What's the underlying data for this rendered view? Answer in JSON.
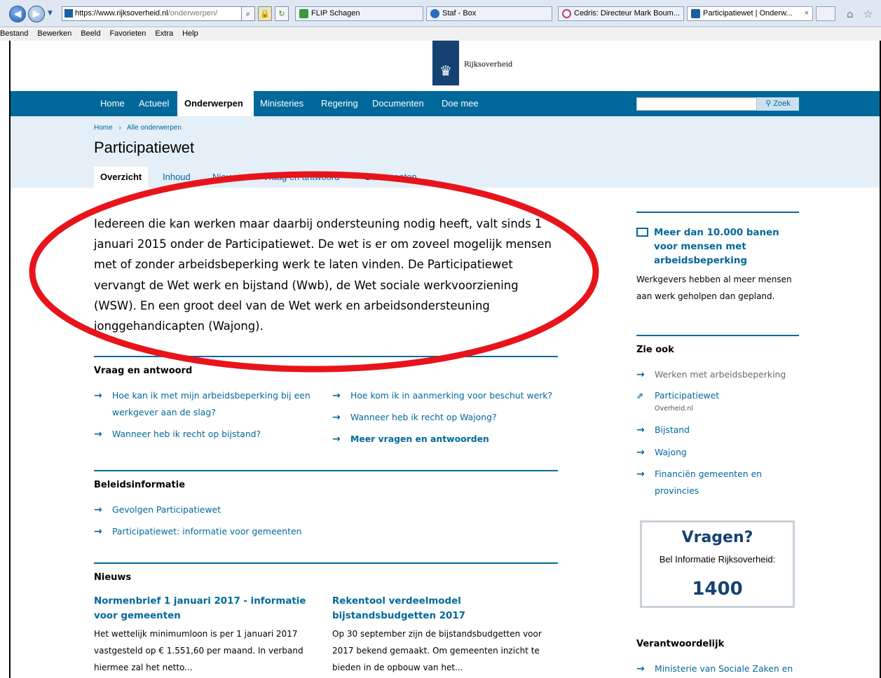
{
  "browser": {
    "url_host": "https://www.rijksoverheid.nl",
    "url_rest": "/onderwerpen/",
    "tabs": [
      {
        "label": "FLIP Schagen",
        "color": "#3a9a3a"
      },
      {
        "label": "Staf - Box",
        "color": "#2b6cc4"
      },
      {
        "label": "Cedris: Directeur Mark Boum...",
        "color": "#b33d6e"
      },
      {
        "label": "Participatiewet | Onderw...",
        "color": "#1b5ea3"
      }
    ],
    "tab_close": "×"
  },
  "menu": [
    "Bestand",
    "Bewerken",
    "Beeld",
    "Favorieten",
    "Extra",
    "Help"
  ],
  "logo": {
    "text": "Rijksoverheid"
  },
  "nav": [
    "Home",
    "Actueel",
    "Onderwerpen",
    "Ministeries",
    "Regering",
    "Documenten",
    "Doe mee"
  ],
  "search": {
    "button": "Zoek"
  },
  "breadcrumb": {
    "home": "Home",
    "sep": "›",
    "current": "Alle onderwerpen"
  },
  "page": {
    "title": "Participatiewet"
  },
  "subtabs": [
    "Overzicht",
    "Inhoud",
    "Nieuws",
    "Vraag en antwoord",
    "Documenten"
  ],
  "intro": "Iedereen die kan werken maar daarbij ondersteuning nodig heeft, valt sinds 1 januari 2015 onder de Participatiewet. De wet is er om zoveel mogelijk mensen met of zonder arbeidsbeperking werk te laten vinden. De Participatiewet vervangt de Wet werk en bijstand (Wwb), de Wet sociale werkvoorziening (WSW). En een groot deel van de Wet werk en arbeidsondersteuning jonggehandicapten (Wajong).",
  "qa": {
    "heading": "Vraag en antwoord",
    "left": [
      "Hoe kan ik met mijn arbeidsbeperking bij een werkgever aan de slag?",
      "Wanneer heb ik recht op bijstand?"
    ],
    "right": [
      "Hoe kom ik in aanmerking voor beschut werk?",
      "Wanneer heb ik recht op Wajong?",
      "Meer vragen en antwoorden"
    ]
  },
  "policy": {
    "heading": "Beleidsinformatie",
    "links": [
      "Gevolgen Participatiewet",
      "Participatiewet: informatie voor gemeenten"
    ]
  },
  "news": {
    "heading": "Nieuws",
    "items": [
      {
        "title": "Normenbrief 1 januari 2017 - informatie voor gemeenten",
        "text": "Het wettelijk minimumloon is per 1 januari 2017 vastgesteld op € 1.551,60 per maand. In verband hiermee zal het netto..."
      },
      {
        "title": "Rekentool verdeelmodel bijstandsbudgetten 2017",
        "text": "Op 30 september zijn de bijstandsbudgetten voor 2017 bekend gemaakt. Om gemeenten inzicht te bieden in de opbouw van het..."
      }
    ]
  },
  "sidebar": {
    "banner_title": "Meer dan 10.000 banen voor mensen met arbeidsbeperking",
    "banner_text": "Werkgevers hebben al meer mensen aan werk geholpen dan gepland.",
    "see_also": "Zie ook",
    "links": [
      "Werken met arbeidsbeperking",
      "Participatiewet",
      "Bijstand",
      "Wajong",
      "Financiën gemeenten en provincies"
    ],
    "overheid": "Overheid.nl",
    "questions_title": "Vragen?",
    "questions_text": "Bel Informatie Rijksoverheid:",
    "questions_number": "1400",
    "responsible": "Verantwoordelijk",
    "responsible_link": "Ministerie van Sociale Zaken en"
  },
  "annotation_color": "#e8141b"
}
